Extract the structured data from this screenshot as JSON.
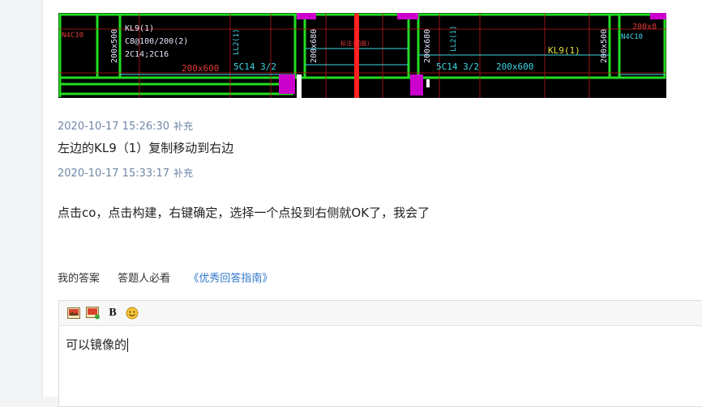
{
  "drawing": {
    "labels": {
      "n4c10_left": "N4C10",
      "kl9_left": "KL9(1)",
      "stirrup_left": "C8@100/200(2)",
      "top_bar_left": "2C14;2C16",
      "size_200x500_left": "200x500",
      "ll_left": "LL2(1)",
      "beam_200x600_a": "200x600",
      "bar_5c14_a": "5C14 3/2",
      "size_200x680_mid": "200x680",
      "annotation_mid": "标注(图题)",
      "size_200x680_right": "200x680",
      "ll_right": "LL2(1)",
      "bar_5c14_b": "5C14 3/2",
      "beam_200x600_b": "200x600",
      "kl9_right": "KL9(1)",
      "size_200x500_right": "200x500",
      "n4c10_right": "N4C10",
      "size_200x8_right": "200x8"
    }
  },
  "thread": [
    {
      "timestamp": "2020-10-17 15:26:30",
      "tag": "补充",
      "text": "左边的KL9（1）复制移动到右边"
    },
    {
      "timestamp": "2020-10-17 15:33:17",
      "tag": "补充",
      "text": "点击co，点击构建，右键确定，选择一个点投到右侧就OK了，我会了"
    }
  ],
  "tabs": {
    "my_answer": "我的答案",
    "must_read": "答题人必看",
    "guide_link": "《优秀回答指南》"
  },
  "editor": {
    "bold_label": "B",
    "content": "可以镜像的"
  },
  "colors": {
    "accent_link": "#2d76c8",
    "timestamp": "#6f86a7",
    "cad_green": "#22dd22",
    "cad_magenta": "#cc00cc",
    "cad_red": "#ff2020"
  }
}
